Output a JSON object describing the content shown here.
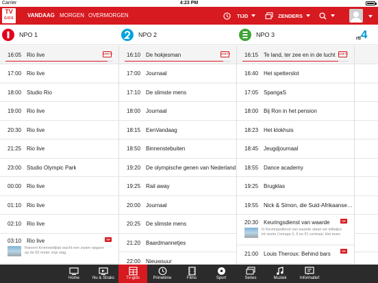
{
  "status_bar": {
    "carrier": "Carrier",
    "time": "4:23 PM",
    "battery_level": 0.85
  },
  "app": {
    "logo_line1": "TV",
    "logo_line2": "GIDS"
  },
  "day_tabs": [
    {
      "label": "VANDAAG",
      "active": true
    },
    {
      "label": "MORGEN",
      "active": false
    },
    {
      "label": "OVERMORGEN",
      "active": false
    }
  ],
  "toolbar": {
    "time_label": "TIJD",
    "channels_label": "ZENDERS",
    "clock_icon": "clock-icon",
    "channels_icon": "stacked-screens-icon",
    "search_icon": "search-icon",
    "profile_icon": "user-icon"
  },
  "colors": {
    "brand_red": "#d71920",
    "npo1": "#e2001a",
    "npo2": "#00a3e0",
    "npo3": "#3fa535",
    "rtl4_blue": "#0099d4",
    "bottom_bar": "#2b2b2b"
  },
  "channels": [
    {
      "name": "NPO 1",
      "logo_text": "npo",
      "programs": [
        {
          "time": "16:05",
          "title": "Rio live",
          "now": true,
          "progress": 0.95,
          "live_badge": "LIVE TV"
        },
        {
          "time": "17:00",
          "title": "Rio live"
        },
        {
          "time": "18:00",
          "title": "Studio Rio"
        },
        {
          "time": "19:00",
          "title": "Rio live"
        },
        {
          "time": "20:30",
          "title": "Rio live"
        },
        {
          "time": "21:25",
          "title": "Rio live"
        },
        {
          "time": "23:00",
          "title": "Studio Olympic Park"
        },
        {
          "time": "00:00",
          "title": "Rio live"
        },
        {
          "time": "01:10",
          "title": "Rio live"
        },
        {
          "time": "02:10",
          "title": "Rio live"
        },
        {
          "time": "03:10",
          "title": "Rio live",
          "tip": "TIP",
          "description": "Ranomi Kromowidjojo wacht een zware opgave op de 50 meter vrije slag."
        }
      ]
    },
    {
      "name": "NPO 2",
      "logo_text": "npo",
      "programs": [
        {
          "time": "16:10",
          "title": "De hokjesman",
          "now": true,
          "progress": 0.93,
          "live_badge": "LIVE TV"
        },
        {
          "time": "17:00",
          "title": "Journaal"
        },
        {
          "time": "17:10",
          "title": "De slimste mens"
        },
        {
          "time": "18:00",
          "title": "Journaal"
        },
        {
          "time": "18:15",
          "title": "EenVandaag"
        },
        {
          "time": "18:50",
          "title": "Binnenstebuiten"
        },
        {
          "time": "19:20",
          "title": "De olympische genen van Nederland"
        },
        {
          "time": "19:25",
          "title": "Rail away"
        },
        {
          "time": "20:00",
          "title": "Journaal"
        },
        {
          "time": "20:25",
          "title": "De slimste mens"
        },
        {
          "time": "21:20",
          "title": "Baardmannetjes"
        },
        {
          "time": "22:00",
          "title": "Nieuwsuur"
        }
      ]
    },
    {
      "name": "NPO 3",
      "logo_text": "npo",
      "programs": [
        {
          "time": "16:15",
          "title": "Te land, ter zee en in de lucht",
          "now": true,
          "progress": 0.9,
          "live_badge": "LIVE TV"
        },
        {
          "time": "16:40",
          "title": "Het spetterslot"
        },
        {
          "time": "17:05",
          "title": "SpangaS"
        },
        {
          "time": "18:00",
          "title": "Bij Ron in het pension"
        },
        {
          "time": "18:23",
          "title": "Het klokhuis"
        },
        {
          "time": "18:45",
          "title": "Jeugdjournaal"
        },
        {
          "time": "18:55",
          "title": "Dance academy"
        },
        {
          "time": "19:25",
          "title": "Brugklas"
        },
        {
          "time": "19:55",
          "title": "Nick & Simon, die Suid-Afrikaanse Boere"
        },
        {
          "time": "20:30",
          "title": "Keuringsdienst van waarde",
          "tip": "TIP",
          "description": "In Keuringsdienst van waarde staan we stilletjes int visole ('omega 3, 6 en 9') centraal. Het team reist af naar België..."
        },
        {
          "time": "21:00",
          "title": "Louis Theroux: Behind bars",
          "tip": "TIP"
        }
      ]
    },
    {
      "name": "RTL 4",
      "logo_text": "rtl 4"
    }
  ],
  "bottom_nav": [
    {
      "label": "Home",
      "icon": "home-icon",
      "active": false
    },
    {
      "label": "Nu & Straks",
      "icon": "tv-now-icon",
      "active": false
    },
    {
      "label": "Tv-gids",
      "icon": "guide-grid-icon",
      "active": true
    },
    {
      "label": "Primetime",
      "icon": "clock-icon",
      "active": false
    },
    {
      "label": "Films",
      "icon": "film-icon",
      "active": false
    },
    {
      "label": "Sport",
      "icon": "soccer-ball-icon",
      "active": false
    },
    {
      "label": "Series",
      "icon": "series-icon",
      "active": false
    },
    {
      "label": "Muziek",
      "icon": "music-note-icon",
      "active": false
    },
    {
      "label": "Informatief",
      "icon": "info-icon",
      "active": false
    }
  ]
}
